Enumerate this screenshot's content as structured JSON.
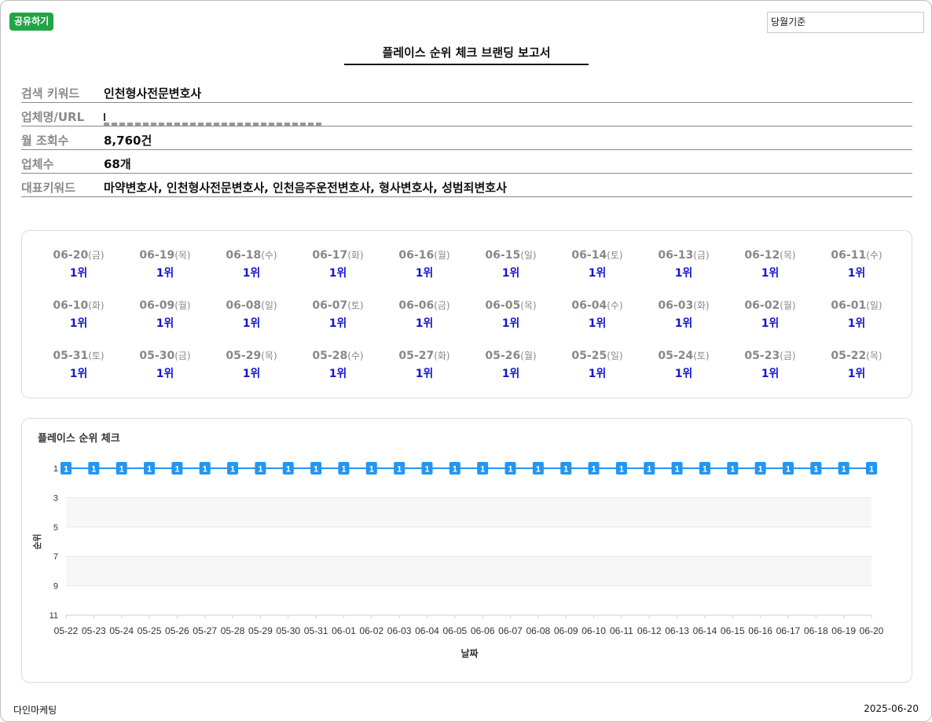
{
  "header": {
    "share_label": "공유하기",
    "period_value": "당월기준",
    "title": "플레이스 순위 체크 브랜딩 보고서"
  },
  "info": [
    {
      "label": "검색 키워드",
      "value": "인천형사전문변호사"
    },
    {
      "label": "업체명/URL",
      "value": ""
    },
    {
      "label": "월 조회수",
      "value": "8,760건"
    },
    {
      "label": "업체수",
      "value": "68개"
    },
    {
      "label": "대표키워드",
      "value": "마약변호사, 인천형사전문변호사, 인천음주운전변호사, 형사변호사, 성범죄변호사"
    }
  ],
  "ranks": [
    {
      "date": "06-20",
      "dow": "(금)",
      "rank": "1위"
    },
    {
      "date": "06-19",
      "dow": "(목)",
      "rank": "1위"
    },
    {
      "date": "06-18",
      "dow": "(수)",
      "rank": "1위"
    },
    {
      "date": "06-17",
      "dow": "(화)",
      "rank": "1위"
    },
    {
      "date": "06-16",
      "dow": "(월)",
      "rank": "1위"
    },
    {
      "date": "06-15",
      "dow": "(일)",
      "rank": "1위"
    },
    {
      "date": "06-14",
      "dow": "(토)",
      "rank": "1위"
    },
    {
      "date": "06-13",
      "dow": "(금)",
      "rank": "1위"
    },
    {
      "date": "06-12",
      "dow": "(목)",
      "rank": "1위"
    },
    {
      "date": "06-11",
      "dow": "(수)",
      "rank": "1위"
    },
    {
      "date": "06-10",
      "dow": "(화)",
      "rank": "1위"
    },
    {
      "date": "06-09",
      "dow": "(월)",
      "rank": "1위"
    },
    {
      "date": "06-08",
      "dow": "(일)",
      "rank": "1위"
    },
    {
      "date": "06-07",
      "dow": "(토)",
      "rank": "1위"
    },
    {
      "date": "06-06",
      "dow": "(금)",
      "rank": "1위"
    },
    {
      "date": "06-05",
      "dow": "(목)",
      "rank": "1위"
    },
    {
      "date": "06-04",
      "dow": "(수)",
      "rank": "1위"
    },
    {
      "date": "06-03",
      "dow": "(화)",
      "rank": "1위"
    },
    {
      "date": "06-02",
      "dow": "(월)",
      "rank": "1위"
    },
    {
      "date": "06-01",
      "dow": "(일)",
      "rank": "1위"
    },
    {
      "date": "05-31",
      "dow": "(토)",
      "rank": "1위"
    },
    {
      "date": "05-30",
      "dow": "(금)",
      "rank": "1위"
    },
    {
      "date": "05-29",
      "dow": "(목)",
      "rank": "1위"
    },
    {
      "date": "05-28",
      "dow": "(수)",
      "rank": "1위"
    },
    {
      "date": "05-27",
      "dow": "(화)",
      "rank": "1위"
    },
    {
      "date": "05-26",
      "dow": "(월)",
      "rank": "1위"
    },
    {
      "date": "05-25",
      "dow": "(일)",
      "rank": "1위"
    },
    {
      "date": "05-24",
      "dow": "(토)",
      "rank": "1위"
    },
    {
      "date": "05-23",
      "dow": "(금)",
      "rank": "1위"
    },
    {
      "date": "05-22",
      "dow": "(목)",
      "rank": "1위"
    }
  ],
  "chart_data": {
    "type": "line",
    "title": "플레이스 순위 체크",
    "xlabel": "날짜",
    "ylabel": "순위",
    "y_inverted": true,
    "ylim": [
      1,
      11
    ],
    "yticks": [
      1,
      3,
      5,
      7,
      9,
      11
    ],
    "x": [
      "05-22",
      "05-23",
      "05-24",
      "05-25",
      "05-26",
      "05-27",
      "05-28",
      "05-29",
      "05-30",
      "05-31",
      "06-01",
      "06-02",
      "06-03",
      "06-04",
      "06-05",
      "06-06",
      "06-07",
      "06-08",
      "06-09",
      "06-10",
      "06-11",
      "06-12",
      "06-13",
      "06-14",
      "06-15",
      "06-16",
      "06-17",
      "06-18",
      "06-19",
      "06-20"
    ],
    "series": [
      {
        "values": [
          1,
          1,
          1,
          1,
          1,
          1,
          1,
          1,
          1,
          1,
          1,
          1,
          1,
          1,
          1,
          1,
          1,
          1,
          1,
          1,
          1,
          1,
          1,
          1,
          1,
          1,
          1,
          1,
          1,
          1
        ],
        "color": "#2196f3"
      }
    ],
    "grid": true,
    "band_colors": [
      "#ffffff",
      "#f7f7f7"
    ]
  },
  "footer": {
    "company": "다인마케팅",
    "date": "2025-06-20"
  }
}
